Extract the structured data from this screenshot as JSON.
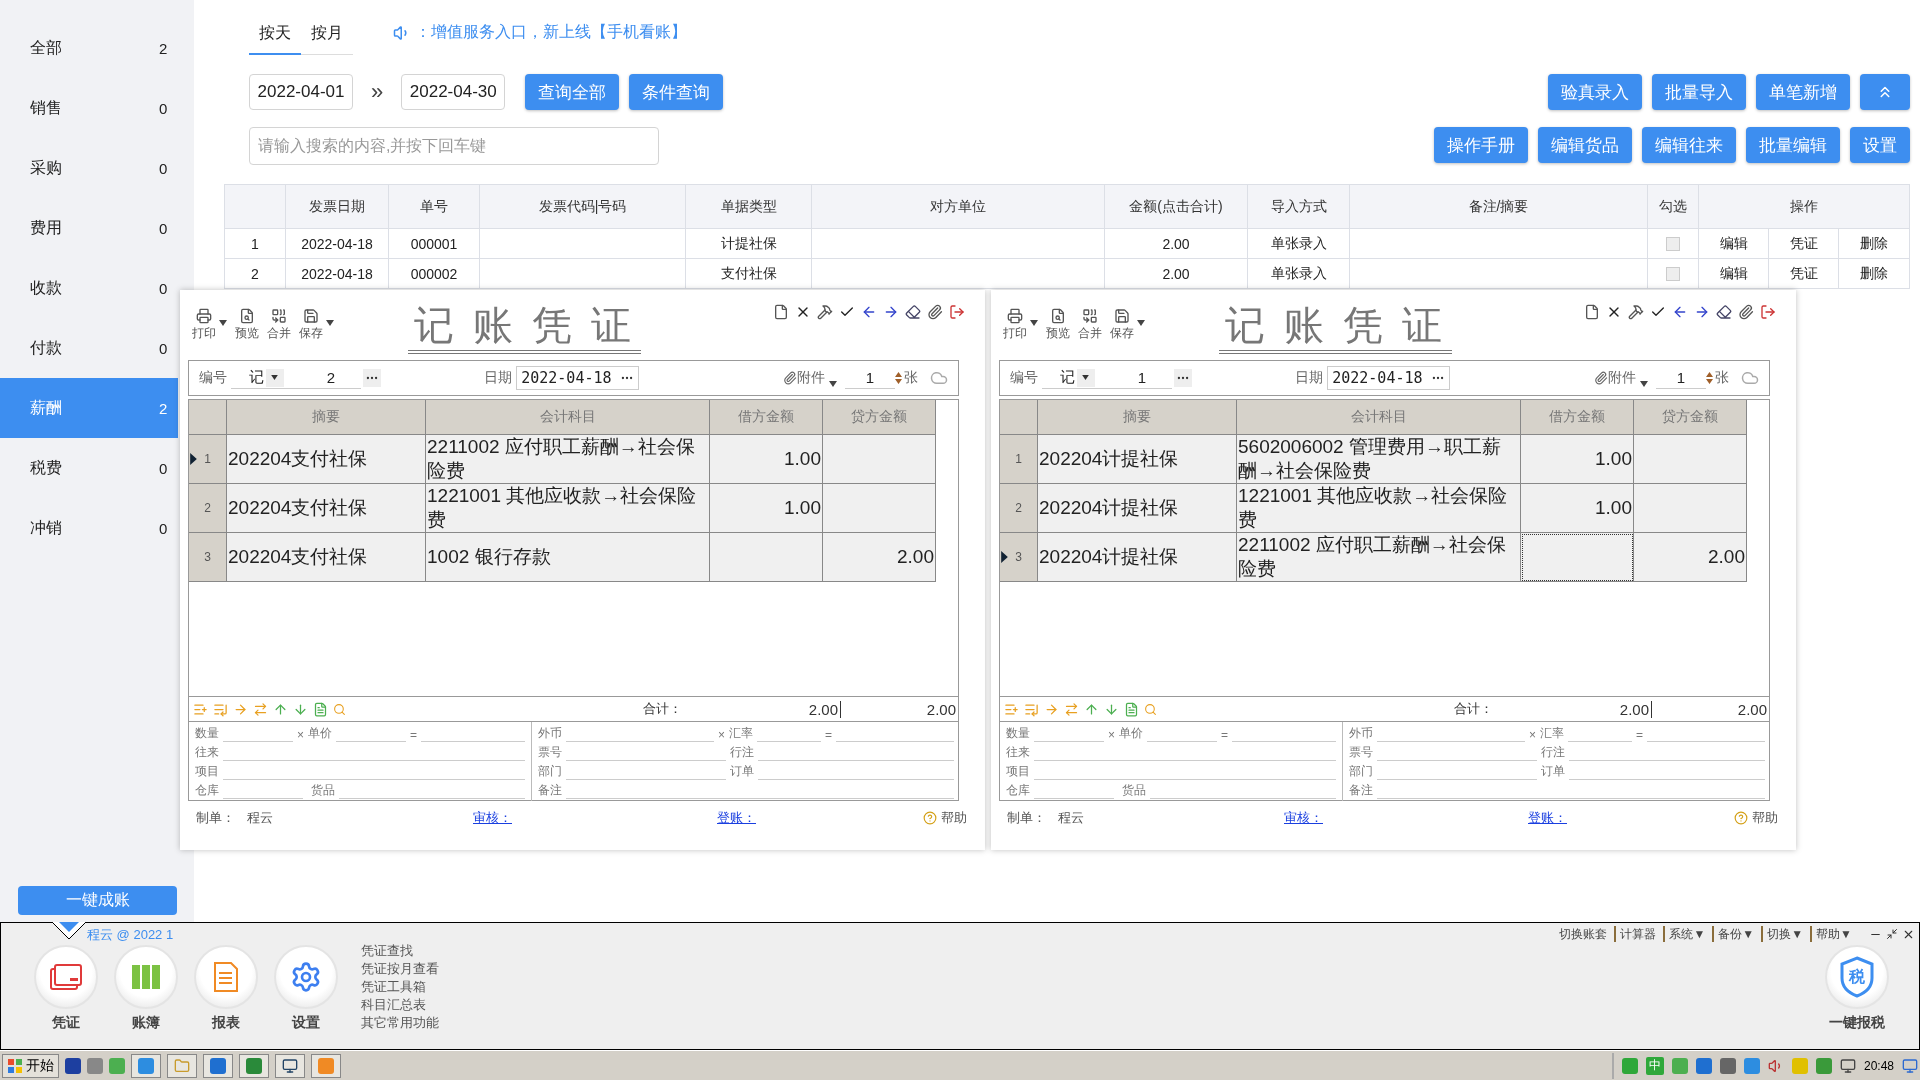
{
  "sidebar": {
    "items": [
      {
        "label": "全部",
        "count": "2",
        "selected": false
      },
      {
        "label": "销售",
        "count": "0",
        "selected": false
      },
      {
        "label": "采购",
        "count": "0",
        "selected": false
      },
      {
        "label": "费用",
        "count": "0",
        "selected": false
      },
      {
        "label": "收款",
        "count": "0",
        "selected": false
      },
      {
        "label": "付款",
        "count": "0",
        "selected": false
      },
      {
        "label": "薪酬",
        "count": "2",
        "selected": true
      },
      {
        "label": "税费",
        "count": "0",
        "selected": false
      },
      {
        "label": "冲销",
        "count": "0",
        "selected": false
      }
    ],
    "action_button": "一键成账"
  },
  "view_tabs": [
    {
      "label": "按天",
      "selected": true
    },
    {
      "label": "按月",
      "selected": false
    }
  ],
  "notice": "：增值服务入口，新上线【手机看账】",
  "date_from": "2022-04-01",
  "date_separator": "»",
  "date_to": "2022-04-30",
  "query_buttons": [
    "查询全部",
    "条件查询"
  ],
  "search": {
    "placeholder": "请输入搜索的内容,并按下回车键"
  },
  "action_buttons_top": [
    "验真录入",
    "批量导入",
    "单笔新增"
  ],
  "action_buttons_bottom": [
    "操作手册",
    "编辑货品",
    "编辑往来",
    "批量编辑",
    "设置"
  ],
  "table": {
    "columns": [
      "发票日期",
      "单号",
      "发票代码|号码",
      "单据类型",
      "对方单位",
      "金额(点击合计)",
      "导入方式",
      "备注/摘要",
      "勾选",
      "操作"
    ],
    "rows": [
      {
        "index": "1",
        "date": "2022-04-18",
        "number": "000001",
        "type": "计提社保",
        "amount": "2.00",
        "import_method": "单张录入",
        "checked": false,
        "actions": [
          "编辑",
          "凭证",
          "删除"
        ]
      },
      {
        "index": "2",
        "date": "2022-04-18",
        "number": "000002",
        "type": "支付社保",
        "amount": "2.00",
        "import_method": "单张录入",
        "checked": false,
        "actions": [
          "编辑",
          "凭证",
          "删除"
        ]
      }
    ]
  },
  "vouchers": [
    {
      "title": "记 账 凭 证",
      "toolbar": [
        {
          "label": "打印",
          "kind": "print",
          "dropdown": true
        },
        {
          "label": "预览",
          "kind": "preview",
          "dropdown": false
        },
        {
          "label": "合并",
          "kind": "merge",
          "dropdown": false
        },
        {
          "label": "保存",
          "kind": "save",
          "dropdown": true
        }
      ],
      "number_label": "编号",
      "word": "记",
      "number": "2",
      "date_label": "日期",
      "date": "2022-04-18",
      "attach_label": "附件",
      "attach_count": "1",
      "unit": "张",
      "columns": [
        "摘要",
        "会计科目",
        "借方金额",
        "贷方金额"
      ],
      "rows": [
        {
          "index": "1",
          "summary": "202204支付社保",
          "account": "2211002 应付职工薪酬→社会保险费",
          "debit": "1.00",
          "selected": true
        },
        {
          "index": "2",
          "summary": "202204支付社保",
          "account": "1221001 其他应收款→社会保险费",
          "debit": "1.00",
          "selected": false
        },
        {
          "index": "3",
          "summary": "202204支付社保",
          "account": "1002 银行存款",
          "credit": "2.00",
          "selected": false
        }
      ],
      "total_label": "合计：",
      "total_debit": "2.00",
      "total_credit": "2.00",
      "details": {
        "quantity": "数量",
        "times": "×",
        "price": "单价",
        "equals": "=",
        "partner": "往来",
        "project": "项目",
        "warehouse": "仓库",
        "goods": "货品",
        "currency": "外币",
        "times2": "×",
        "rate": "汇率",
        "equals2": "=",
        "ticket": "票号",
        "line_note": "行注",
        "dept": "部门",
        "order": "订单",
        "remark": "备注"
      },
      "maker_label": "制单：",
      "maker": "程云",
      "review": "审核：",
      "post": "登账：",
      "help": "帮助"
    },
    {
      "title": "记 账 凭 证",
      "toolbar": [
        {
          "label": "打印",
          "kind": "print",
          "dropdown": true
        },
        {
          "label": "预览",
          "kind": "preview",
          "dropdown": false
        },
        {
          "label": "合并",
          "kind": "merge",
          "dropdown": false
        },
        {
          "label": "保存",
          "kind": "save",
          "dropdown": true
        }
      ],
      "number_label": "编号",
      "word": "记",
      "number": "1",
      "date_label": "日期",
      "date": "2022-04-18",
      "attach_label": "附件",
      "attach_count": "1",
      "unit": "张",
      "columns": [
        "摘要",
        "会计科目",
        "借方金额",
        "贷方金额"
      ],
      "rows": [
        {
          "index": "1",
          "summary": "202204计提社保",
          "account": "5602006002 管理费用→职工薪酬→社会保险费",
          "debit": "1.00",
          "selected": false
        },
        {
          "index": "2",
          "summary": "202204计提社保",
          "account": "1221001 其他应收款→社会保险费",
          "debit": "1.00",
          "selected": false
        },
        {
          "index": "3",
          "summary": "202204计提社保",
          "account": "2211002 应付职工薪酬→社会保险费",
          "credit": "2.00",
          "selected": true
        }
      ],
      "total_label": "合计：",
      "total_debit": "2.00",
      "total_credit": "2.00",
      "details": {
        "quantity": "数量",
        "times": "×",
        "price": "单价",
        "equals": "=",
        "partner": "往来",
        "project": "项目",
        "warehouse": "仓库",
        "goods": "货品",
        "currency": "外币",
        "times2": "×",
        "rate": "汇率",
        "equals2": "=",
        "ticket": "票号",
        "line_note": "行注",
        "dept": "部门",
        "order": "订单",
        "remark": "备注"
      },
      "maker_label": "制单：",
      "maker": "程云",
      "review": "审核：",
      "post": "登账：",
      "help": "帮助"
    }
  ],
  "bottom_bar": {
    "account": "程云 @ 2022 1",
    "modules": [
      {
        "label": "凭证",
        "kind": "voucher"
      },
      {
        "label": "账簿",
        "kind": "ledger"
      },
      {
        "label": "报表",
        "kind": "report"
      },
      {
        "label": "设置",
        "kind": "settings"
      }
    ],
    "links": [
      "凭证查找",
      "凭证按月查看",
      "凭证工具箱",
      "科目汇总表",
      "其它常用功能"
    ],
    "menu": [
      "切换账套",
      "计算器",
      "系统▼",
      "备份▼",
      "切换▼",
      "帮助▼"
    ],
    "tax_icon_text": "税",
    "tax_label": "一键报税"
  },
  "taskbar": {
    "start": "开始",
    "ime": "中",
    "clock": "20:48"
  }
}
